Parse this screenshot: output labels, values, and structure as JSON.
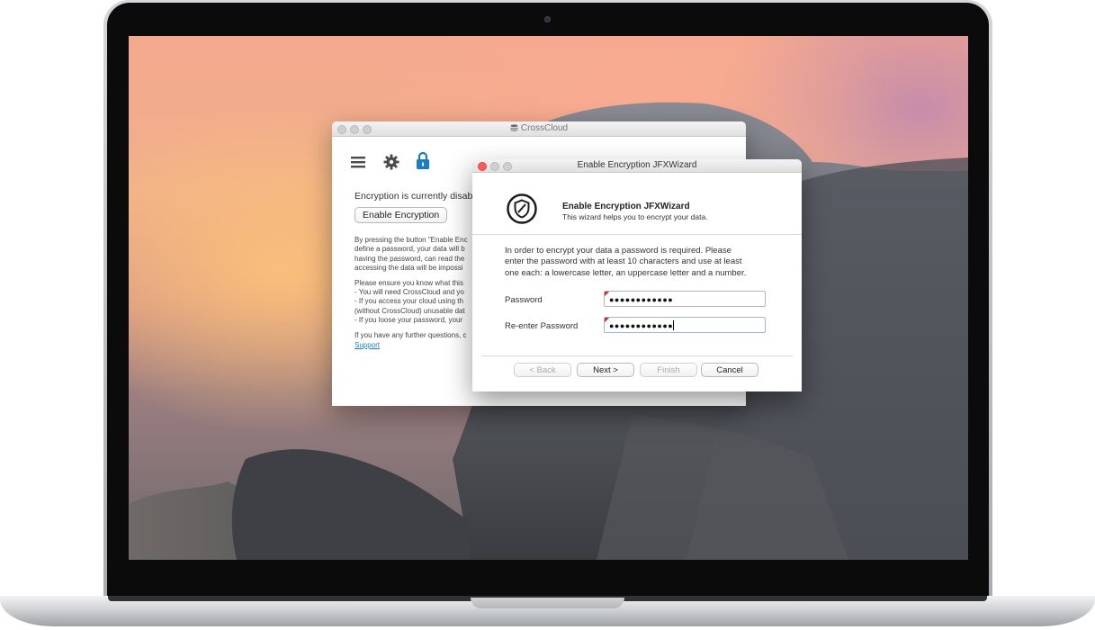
{
  "crosscloud": {
    "title": "CrossCloud",
    "status_text": "Encryption is currently disab",
    "enable_button": "Enable Encryption",
    "para1": [
      "By pressing the button \"Enable Enc",
      "define a password, your data will b",
      "having the password, can read the",
      "accessing the data will be impossi"
    ],
    "para2": [
      "Please ensure you know what this",
      "- You will need CrossCloud and yo",
      "- If you access your cloud using th",
      "(without CrossCloud) unusable dat",
      "- If you loose your password, your"
    ],
    "para3": "If you have any further questions, c",
    "support_link": "Support",
    "icons": [
      "hamburger-menu-icon",
      "gear-icon",
      "lock-icon"
    ],
    "accent_color": "#1a7cc4"
  },
  "wizard": {
    "title": "Enable Encryption JFXWizard",
    "header_title": "Enable Encryption JFXWizard",
    "header_subtitle": "This wizard helps you to encrypt your data.",
    "description_lines": [
      "In order to encrypt your data a password is required. Please",
      "enter the password with at least 10 characters and use at least",
      "one each: a lowercase letter, an uppercase letter and a number."
    ],
    "password_label": "Password",
    "password_value": "●●●●●●●●●●●●",
    "reenter_label": "Re-enter Password",
    "reenter_value": "●●●●●●●●●●●●",
    "back_button": "< Back",
    "next_button": "Next >",
    "finish_button": "Finish",
    "cancel_button": "Cancel",
    "close_color": "#ff5f57"
  }
}
